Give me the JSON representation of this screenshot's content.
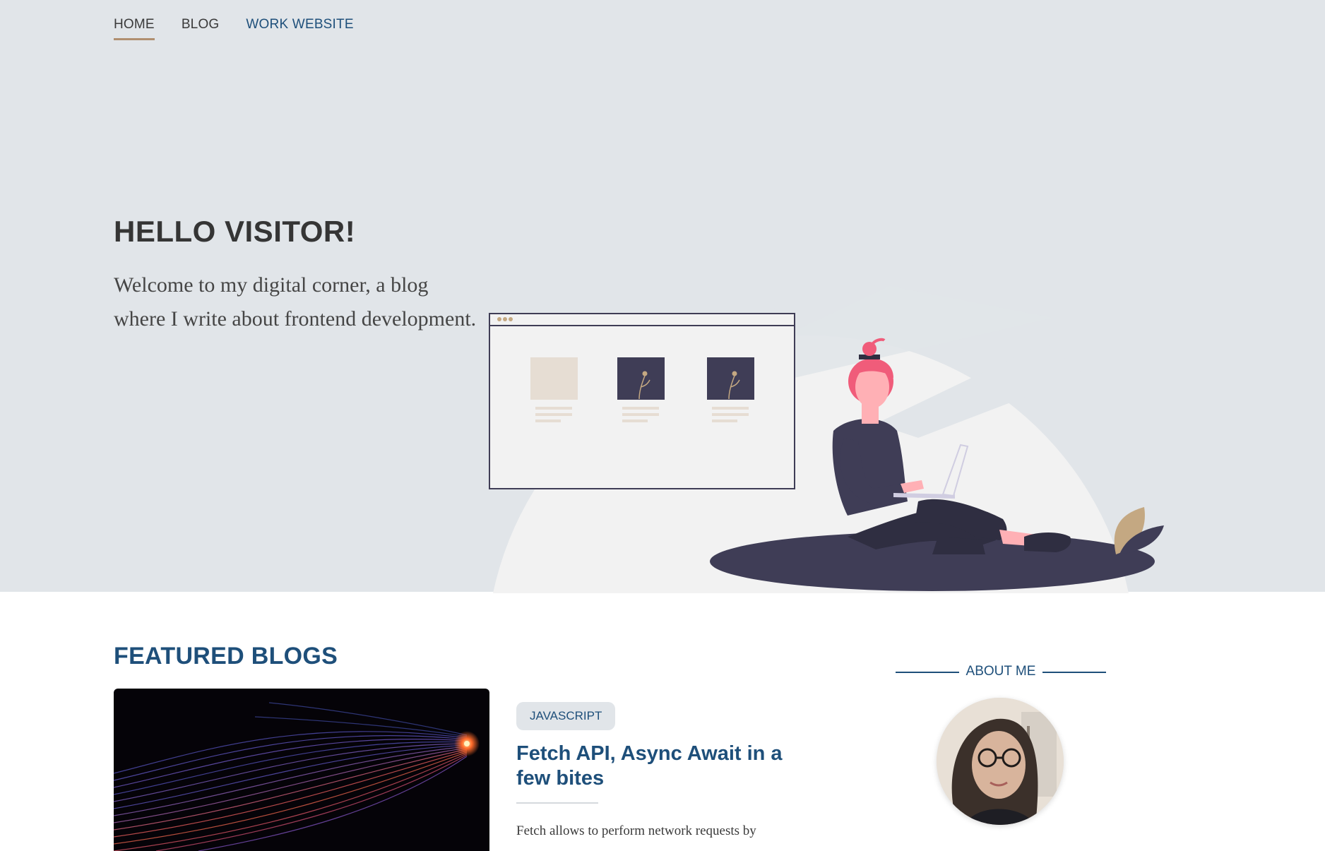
{
  "nav": {
    "items": [
      {
        "label": "HOME"
      },
      {
        "label": "BLOG"
      },
      {
        "label": "WORK WEBSITE"
      }
    ],
    "active": "HOME"
  },
  "hero": {
    "title": "HELLO VISITOR!",
    "text": "Welcome to my digital corner, a blog where I write about frontend development."
  },
  "featured": {
    "title": "FEATURED BLOGS",
    "post": {
      "tag": "JAVASCRIPT",
      "title": "Fetch API, Async Await in a few bites",
      "excerpt": "Fetch allows to perform network requests by"
    }
  },
  "about": {
    "label": "ABOUT ME"
  },
  "colors": {
    "hero_bg": "#e1e5e9",
    "accent_blue": "#1e4f7a",
    "nav_underline": "#b08f70",
    "dark_purple": "#3f3d56",
    "pink_hair": "#f05c7a"
  },
  "icons": [
    "illustration-woman-laptop",
    "browser-window-illustration",
    "blog-cover-light-trails",
    "profile-photo"
  ]
}
